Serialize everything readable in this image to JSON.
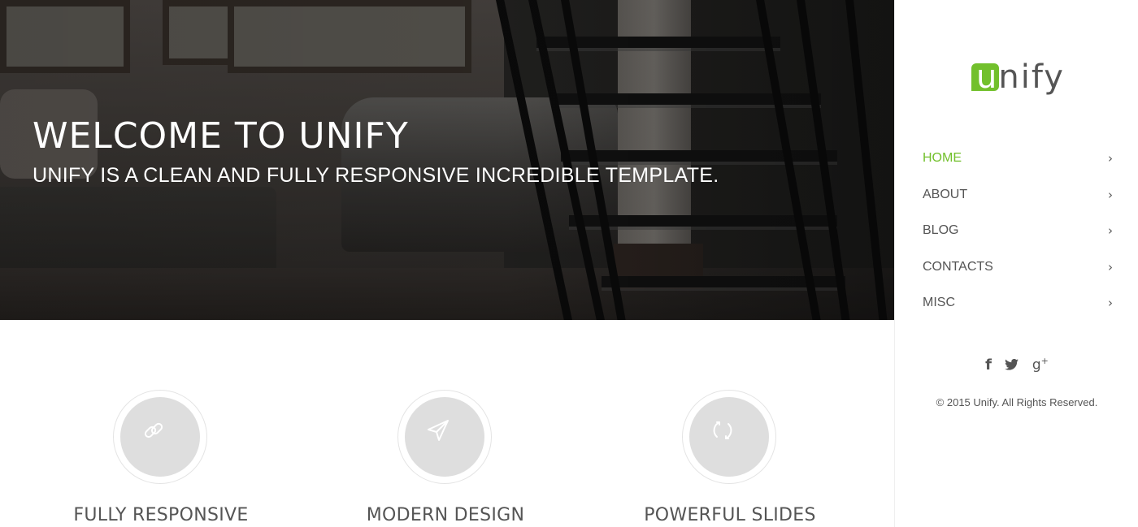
{
  "hero": {
    "title": "WELCOME TO UNIFY",
    "subtitle": "UNIFY IS A CLEAN AND FULLY RESPONSIVE INCREDIBLE TEMPLATE."
  },
  "sidebar": {
    "logo": {
      "first_letter": "u",
      "rest": "nify"
    },
    "nav": [
      {
        "label": "HOME",
        "active": true
      },
      {
        "label": "ABOUT",
        "active": false
      },
      {
        "label": "BLOG",
        "active": false
      },
      {
        "label": "CONTACTS",
        "active": false
      },
      {
        "label": "MISC",
        "active": false
      }
    ],
    "social": [
      {
        "icon": "facebook-icon",
        "glyph": "f"
      },
      {
        "icon": "twitter-icon",
        "glyph": "🐦︎"
      },
      {
        "icon": "google-plus-icon",
        "glyph": "g+"
      }
    ],
    "copyright": "© 2015 Unify. All Rights Reserved."
  },
  "features": [
    {
      "icon": "link-icon",
      "title": "FULLY RESPONSIVE"
    },
    {
      "icon": "paper-plane-icon",
      "title": "MODERN DESIGN"
    },
    {
      "icon": "refresh-icon",
      "title": "POWERFUL SLIDES"
    }
  ],
  "colors": {
    "accent": "#72c02c",
    "text": "#555555",
    "icon_circle": "#dedede"
  }
}
